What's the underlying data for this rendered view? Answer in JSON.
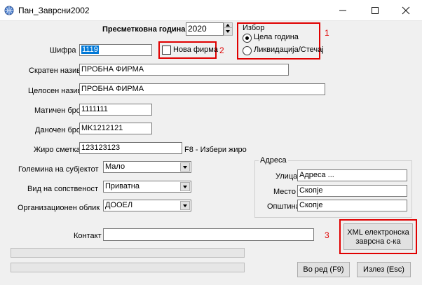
{
  "window": {
    "title": "Пан_Заврсни2002"
  },
  "header": {
    "year_label": "Пресметковна година",
    "year_value": "2020"
  },
  "choice": {
    "group_title": "Избор",
    "options": [
      "Цела година",
      "Ликвидација/Стечај"
    ],
    "selected": "Цела година"
  },
  "fields": {
    "code_label": "Шифра",
    "code_value": "1119",
    "new_company_label": "Нова фирма",
    "short_name_label": "Скратен назив",
    "short_name_value": "ПРОБНА ФИРМА",
    "full_name_label": "Целосен назив",
    "full_name_value": "ПРОБНА ФИРМА",
    "reg_no_label": "Матичен број",
    "reg_no_value": "1111111",
    "tax_no_label": "Даночен број",
    "tax_no_value": "MK1212121",
    "account_label": "Жиро сметка",
    "account_value": "123123123",
    "account_hint": "F8 - Избери жиро",
    "size_label": "Големина на субјектот",
    "size_value": "Мало",
    "ownership_label": "Вид на сопственост",
    "ownership_value": "Приватна",
    "org_form_label": "Организационен облик",
    "org_form_value": "ДООЕЛ",
    "contact_label": "Контакт",
    "contact_value": ""
  },
  "address": {
    "group_title": "Адреса",
    "street_label": "Улица",
    "street_value": "Адреса ...",
    "place_label": "Место",
    "place_value": "Скопје",
    "municipality_label": "Општина",
    "municipality_value": "Скопје"
  },
  "buttons": {
    "xml_line1": "XML електронска",
    "xml_line2": "заврсна с-ка",
    "ok": "Во ред (F9)",
    "exit": "Излез (Esc)"
  },
  "annotations": {
    "n1": "1",
    "n2": "2",
    "n3": "3",
    "color": "#e00000"
  }
}
